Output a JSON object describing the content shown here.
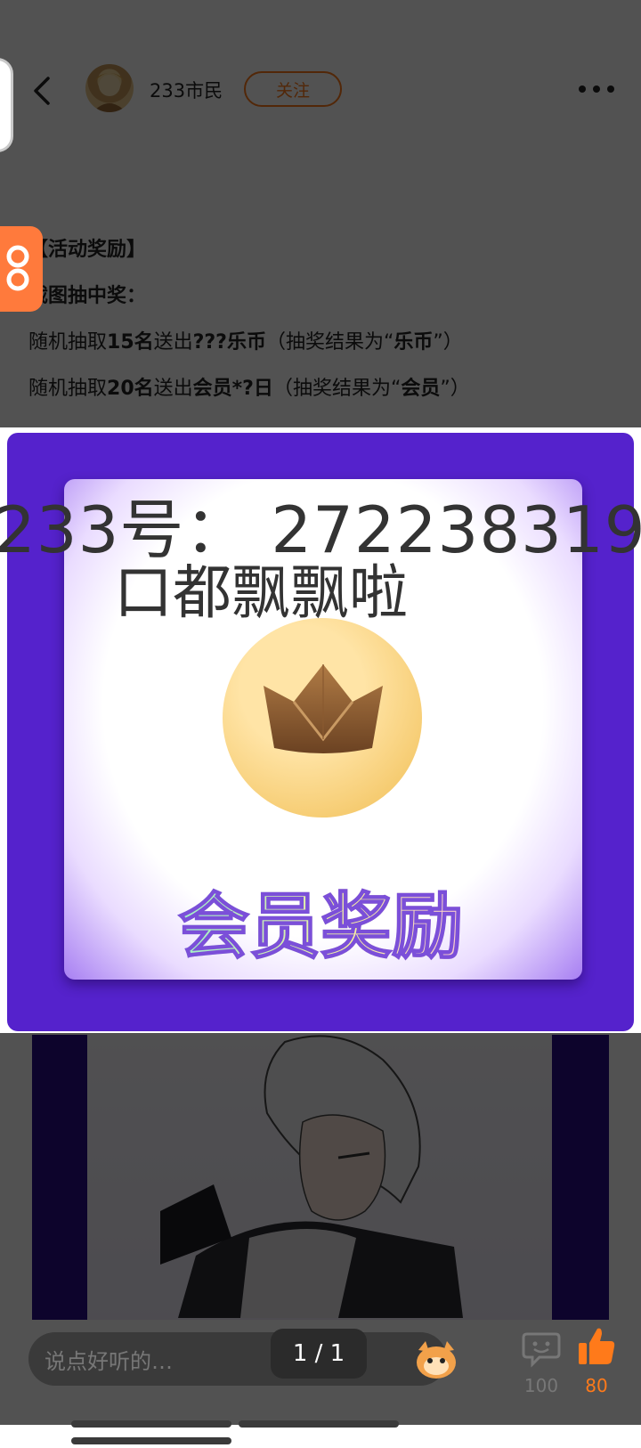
{
  "header": {
    "username": "233市民",
    "follow_label": "关注",
    "back_icon": "chevron-left-icon",
    "more_icon": "more-dots-icon"
  },
  "post": {
    "line1": "【活动奖励】",
    "line2": "截图抽中奖：",
    "line3": {
      "a": "随机抽取",
      "b": "15名",
      "c": "送出",
      "d": "???乐币",
      "e": "（抽奖结果为“",
      "f": "乐币",
      "g": "”）"
    },
    "line4": {
      "a": "随机抽取",
      "b": "20名",
      "c": "送出",
      "d": "会员*?日",
      "e": "（抽奖结果为“",
      "f": "会员",
      "g": "”）"
    }
  },
  "image": {
    "overlay_line1": "233号： 272238319",
    "overlay_line2": "口都飘飘啦",
    "reward_title": "会员奖励"
  },
  "bottom": {
    "comment_placeholder": "说点好听的…",
    "page_indicator": "1 / 1",
    "comment_count": "100",
    "like_count": "80"
  },
  "colors": {
    "accent": "#ff7a1a",
    "purple": "#5522cc",
    "like": "#ff7a1a"
  }
}
